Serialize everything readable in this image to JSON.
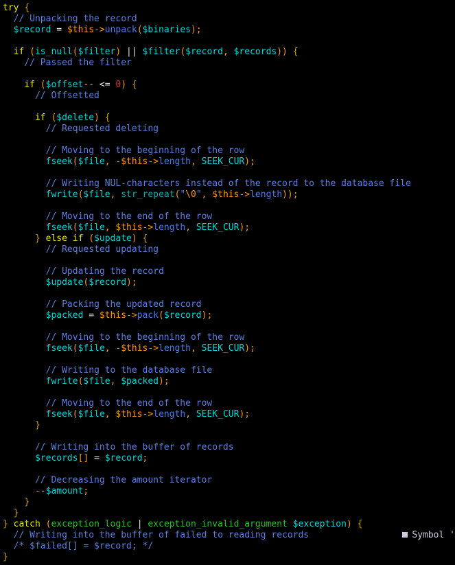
{
  "editor": {
    "background_color": "#000000",
    "font_size_px": 13,
    "line_height_px": 16,
    "language": "PHP"
  },
  "colors": {
    "keyword": "#e8e800",
    "brace": "#c8a000",
    "comment": "#5c7fe0",
    "variable": "#00d8d8",
    "this_variable": "#ff9800",
    "punctuation": "#ff9800",
    "property": "#4a7ae8",
    "function": "#00d8d8",
    "function_secondary": "#13a8a8",
    "operator": "#e6e6e6",
    "number": "#d03030",
    "string": "#4a7ae8",
    "escape": "#ff9800",
    "class_name": "#2bbf2b"
  },
  "overlay": {
    "marker": "square-marker",
    "label": "Symbol",
    "trailing": "'"
  },
  "lines": [
    {
      "n": 1,
      "text": "try {"
    },
    {
      "n": 2,
      "text": "  // Unpacking the record"
    },
    {
      "n": 3,
      "text": "  $record = $this->unpack($binaries);"
    },
    {
      "n": 4,
      "text": ""
    },
    {
      "n": 5,
      "text": "  if (is_null($filter) || $filter($record, $records)) {"
    },
    {
      "n": 6,
      "text": "    // Passed the filter"
    },
    {
      "n": 7,
      "text": ""
    },
    {
      "n": 8,
      "text": "    if ($offset-- <= 0) {"
    },
    {
      "n": 9,
      "text": "      // Offsetted"
    },
    {
      "n": 10,
      "text": ""
    },
    {
      "n": 11,
      "text": "      if ($delete) {"
    },
    {
      "n": 12,
      "text": "        // Requested deleting"
    },
    {
      "n": 13,
      "text": ""
    },
    {
      "n": 14,
      "text": "        // Moving to the beginning of the row"
    },
    {
      "n": 15,
      "text": "        fseek($file, -$this->length, SEEK_CUR);"
    },
    {
      "n": 16,
      "text": ""
    },
    {
      "n": 17,
      "text": "        // Writing NUL-characters instead of the record to the database file"
    },
    {
      "n": 18,
      "text": "        fwrite($file, str_repeat(\"\\0\", $this->length));"
    },
    {
      "n": 19,
      "text": ""
    },
    {
      "n": 20,
      "text": "        // Moving to the end of the row"
    },
    {
      "n": 21,
      "text": "        fseek($file, $this->length, SEEK_CUR);"
    },
    {
      "n": 22,
      "text": "      } else if ($update) {"
    },
    {
      "n": 23,
      "text": "        // Requested updating"
    },
    {
      "n": 24,
      "text": ""
    },
    {
      "n": 25,
      "text": "        // Updating the record"
    },
    {
      "n": 26,
      "text": "        $update($record);"
    },
    {
      "n": 27,
      "text": ""
    },
    {
      "n": 28,
      "text": "        // Packing the updated record"
    },
    {
      "n": 29,
      "text": "        $packed = $this->pack($record);"
    },
    {
      "n": 30,
      "text": ""
    },
    {
      "n": 31,
      "text": "        // Moving to the beginning of the row"
    },
    {
      "n": 32,
      "text": "        fseek($file, -$this->length, SEEK_CUR);"
    },
    {
      "n": 33,
      "text": ""
    },
    {
      "n": 34,
      "text": "        // Writing to the database file"
    },
    {
      "n": 35,
      "text": "        fwrite($file, $packed);"
    },
    {
      "n": 36,
      "text": ""
    },
    {
      "n": 37,
      "text": "        // Moving to the end of the row"
    },
    {
      "n": 38,
      "text": "        fseek($file, $this->length, SEEK_CUR);"
    },
    {
      "n": 39,
      "text": "      }"
    },
    {
      "n": 40,
      "text": ""
    },
    {
      "n": 41,
      "text": "      // Writing into the buffer of records"
    },
    {
      "n": 42,
      "text": "      $records[] = $record;"
    },
    {
      "n": 43,
      "text": ""
    },
    {
      "n": 44,
      "text": "      // Decreasing the amount iterator"
    },
    {
      "n": 45,
      "text": "      --$amount;"
    },
    {
      "n": 46,
      "text": "    }"
    },
    {
      "n": 47,
      "text": "  }"
    },
    {
      "n": 48,
      "text": "} catch (exception_logic | exception_invalid_argument $exception) {"
    },
    {
      "n": 49,
      "text": "  // Writing into the buffer of failed to reading records"
    },
    {
      "n": 50,
      "text": "  /* $failed[] = $record; */"
    },
    {
      "n": 51,
      "text": "}"
    }
  ],
  "tokens": [
    [
      [
        "t-kw",
        "try"
      ],
      [
        "t-plain",
        " "
      ],
      [
        "t-brace",
        "{"
      ]
    ],
    [
      [
        "t-plain",
        "  "
      ],
      [
        "t-comment",
        "// Unpacking the record"
      ]
    ],
    [
      [
        "t-plain",
        "  "
      ],
      [
        "t-var",
        "$record"
      ],
      [
        "t-plain",
        " "
      ],
      [
        "t-op",
        "="
      ],
      [
        "t-plain",
        " "
      ],
      [
        "t-this",
        "$this"
      ],
      [
        "t-punc",
        "->"
      ],
      [
        "t-prop",
        "unpack"
      ],
      [
        "t-punc",
        "("
      ],
      [
        "t-var",
        "$binaries"
      ],
      [
        "t-punc",
        ");"
      ]
    ],
    [],
    [
      [
        "t-plain",
        "  "
      ],
      [
        "t-kw",
        "if"
      ],
      [
        "t-plain",
        " "
      ],
      [
        "t-punc",
        "("
      ],
      [
        "t-func",
        "is_null"
      ],
      [
        "t-punc",
        "("
      ],
      [
        "t-var",
        "$filter"
      ],
      [
        "t-punc",
        ")"
      ],
      [
        "t-plain",
        " "
      ],
      [
        "t-op",
        "||"
      ],
      [
        "t-plain",
        " "
      ],
      [
        "t-var",
        "$filter"
      ],
      [
        "t-punc",
        "("
      ],
      [
        "t-var",
        "$record"
      ],
      [
        "t-punc",
        ","
      ],
      [
        "t-plain",
        " "
      ],
      [
        "t-var",
        "$records"
      ],
      [
        "t-punc",
        "))"
      ],
      [
        "t-plain",
        " "
      ],
      [
        "t-brace",
        "{"
      ]
    ],
    [
      [
        "t-plain",
        "    "
      ],
      [
        "t-comment",
        "// Passed the filter"
      ]
    ],
    [],
    [
      [
        "t-plain",
        "    "
      ],
      [
        "t-kw",
        "if"
      ],
      [
        "t-plain",
        " "
      ],
      [
        "t-punc",
        "("
      ],
      [
        "t-var",
        "$offset"
      ],
      [
        "t-punc",
        "--"
      ],
      [
        "t-plain",
        " "
      ],
      [
        "t-op",
        "<="
      ],
      [
        "t-plain",
        " "
      ],
      [
        "t-num",
        "0"
      ],
      [
        "t-punc",
        ")"
      ],
      [
        "t-plain",
        " "
      ],
      [
        "t-brace",
        "{"
      ]
    ],
    [
      [
        "t-plain",
        "      "
      ],
      [
        "t-comment",
        "// Offsetted"
      ]
    ],
    [],
    [
      [
        "t-plain",
        "      "
      ],
      [
        "t-kw",
        "if"
      ],
      [
        "t-plain",
        " "
      ],
      [
        "t-punc",
        "("
      ],
      [
        "t-var",
        "$delete"
      ],
      [
        "t-punc",
        ")"
      ],
      [
        "t-plain",
        " "
      ],
      [
        "t-brace",
        "{"
      ]
    ],
    [
      [
        "t-plain",
        "        "
      ],
      [
        "t-comment",
        "// Requested deleting"
      ]
    ],
    [],
    [
      [
        "t-plain",
        "        "
      ],
      [
        "t-comment",
        "// Moving to the beginning of the row"
      ]
    ],
    [
      [
        "t-plain",
        "        "
      ],
      [
        "t-func",
        "fseek"
      ],
      [
        "t-punc",
        "("
      ],
      [
        "t-var",
        "$file"
      ],
      [
        "t-punc",
        ","
      ],
      [
        "t-plain",
        " "
      ],
      [
        "t-punc",
        "-"
      ],
      [
        "t-this",
        "$this"
      ],
      [
        "t-punc",
        "->"
      ],
      [
        "t-prop",
        "length"
      ],
      [
        "t-punc",
        ","
      ],
      [
        "t-plain",
        " "
      ],
      [
        "t-func",
        "SEEK_CUR"
      ],
      [
        "t-punc",
        ");"
      ]
    ],
    [],
    [
      [
        "t-plain",
        "        "
      ],
      [
        "t-comment",
        "// Writing NUL-characters instead of the record to the database file"
      ]
    ],
    [
      [
        "t-plain",
        "        "
      ],
      [
        "t-func",
        "fwrite"
      ],
      [
        "t-punc",
        "("
      ],
      [
        "t-var",
        "$file"
      ],
      [
        "t-punc",
        ","
      ],
      [
        "t-plain",
        " "
      ],
      [
        "t-func2",
        "str_repeat"
      ],
      [
        "t-punc",
        "("
      ],
      [
        "t-str",
        "\""
      ],
      [
        "t-esc",
        "\\0"
      ],
      [
        "t-str",
        "\""
      ],
      [
        "t-punc",
        ","
      ],
      [
        "t-plain",
        " "
      ],
      [
        "t-this",
        "$this"
      ],
      [
        "t-punc",
        "->"
      ],
      [
        "t-prop",
        "length"
      ],
      [
        "t-punc",
        "));"
      ]
    ],
    [],
    [
      [
        "t-plain",
        "        "
      ],
      [
        "t-comment",
        "// Moving to the end of the row"
      ]
    ],
    [
      [
        "t-plain",
        "        "
      ],
      [
        "t-func",
        "fseek"
      ],
      [
        "t-punc",
        "("
      ],
      [
        "t-var",
        "$file"
      ],
      [
        "t-punc",
        ","
      ],
      [
        "t-plain",
        " "
      ],
      [
        "t-this",
        "$this"
      ],
      [
        "t-punc",
        "->"
      ],
      [
        "t-prop",
        "length"
      ],
      [
        "t-punc",
        ","
      ],
      [
        "t-plain",
        " "
      ],
      [
        "t-func",
        "SEEK_CUR"
      ],
      [
        "t-punc",
        ");"
      ]
    ],
    [
      [
        "t-plain",
        "      "
      ],
      [
        "t-brace",
        "}"
      ],
      [
        "t-plain",
        " "
      ],
      [
        "t-kw",
        "else if"
      ],
      [
        "t-plain",
        " "
      ],
      [
        "t-punc",
        "("
      ],
      [
        "t-var",
        "$update"
      ],
      [
        "t-punc",
        ")"
      ],
      [
        "t-plain",
        " "
      ],
      [
        "t-brace",
        "{"
      ]
    ],
    [
      [
        "t-plain",
        "        "
      ],
      [
        "t-comment",
        "// Requested updating"
      ]
    ],
    [],
    [
      [
        "t-plain",
        "        "
      ],
      [
        "t-comment",
        "// Updating the record"
      ]
    ],
    [
      [
        "t-plain",
        "        "
      ],
      [
        "t-var",
        "$update"
      ],
      [
        "t-punc",
        "("
      ],
      [
        "t-var",
        "$record"
      ],
      [
        "t-punc",
        ");"
      ]
    ],
    [],
    [
      [
        "t-plain",
        "        "
      ],
      [
        "t-comment",
        "// Packing the updated record"
      ]
    ],
    [
      [
        "t-plain",
        "        "
      ],
      [
        "t-var",
        "$packed"
      ],
      [
        "t-plain",
        " "
      ],
      [
        "t-op",
        "="
      ],
      [
        "t-plain",
        " "
      ],
      [
        "t-this",
        "$this"
      ],
      [
        "t-punc",
        "->"
      ],
      [
        "t-prop",
        "pack"
      ],
      [
        "t-punc",
        "("
      ],
      [
        "t-var",
        "$record"
      ],
      [
        "t-punc",
        ");"
      ]
    ],
    [],
    [
      [
        "t-plain",
        "        "
      ],
      [
        "t-comment",
        "// Moving to the beginning of the row"
      ]
    ],
    [
      [
        "t-plain",
        "        "
      ],
      [
        "t-func",
        "fseek"
      ],
      [
        "t-punc",
        "("
      ],
      [
        "t-var",
        "$file"
      ],
      [
        "t-punc",
        ","
      ],
      [
        "t-plain",
        " "
      ],
      [
        "t-punc",
        "-"
      ],
      [
        "t-this",
        "$this"
      ],
      [
        "t-punc",
        "->"
      ],
      [
        "t-prop",
        "length"
      ],
      [
        "t-punc",
        ","
      ],
      [
        "t-plain",
        " "
      ],
      [
        "t-func",
        "SEEK_CUR"
      ],
      [
        "t-punc",
        ");"
      ]
    ],
    [],
    [
      [
        "t-plain",
        "        "
      ],
      [
        "t-comment",
        "// Writing to the database file"
      ]
    ],
    [
      [
        "t-plain",
        "        "
      ],
      [
        "t-func",
        "fwrite"
      ],
      [
        "t-punc",
        "("
      ],
      [
        "t-var",
        "$file"
      ],
      [
        "t-punc",
        ","
      ],
      [
        "t-plain",
        " "
      ],
      [
        "t-var",
        "$packed"
      ],
      [
        "t-punc",
        ");"
      ]
    ],
    [],
    [
      [
        "t-plain",
        "        "
      ],
      [
        "t-comment",
        "// Moving to the end of the row"
      ]
    ],
    [
      [
        "t-plain",
        "        "
      ],
      [
        "t-func",
        "fseek"
      ],
      [
        "t-punc",
        "("
      ],
      [
        "t-var",
        "$file"
      ],
      [
        "t-punc",
        ","
      ],
      [
        "t-plain",
        " "
      ],
      [
        "t-this",
        "$this"
      ],
      [
        "t-punc",
        "->"
      ],
      [
        "t-prop",
        "length"
      ],
      [
        "t-punc",
        ","
      ],
      [
        "t-plain",
        " "
      ],
      [
        "t-func",
        "SEEK_CUR"
      ],
      [
        "t-punc",
        ");"
      ]
    ],
    [
      [
        "t-plain",
        "      "
      ],
      [
        "t-brace",
        "}"
      ]
    ],
    [],
    [
      [
        "t-plain",
        "      "
      ],
      [
        "t-comment",
        "// Writing into the buffer of records"
      ]
    ],
    [
      [
        "t-plain",
        "      "
      ],
      [
        "t-var",
        "$records"
      ],
      [
        "t-punc",
        "[]"
      ],
      [
        "t-plain",
        " "
      ],
      [
        "t-op",
        "="
      ],
      [
        "t-plain",
        " "
      ],
      [
        "t-var",
        "$record"
      ],
      [
        "t-punc",
        ";"
      ]
    ],
    [],
    [
      [
        "t-plain",
        "      "
      ],
      [
        "t-comment",
        "// Decreasing the amount iterator"
      ]
    ],
    [
      [
        "t-plain",
        "      "
      ],
      [
        "t-punc",
        "--"
      ],
      [
        "t-var",
        "$amount"
      ],
      [
        "t-punc",
        ";"
      ]
    ],
    [
      [
        "t-plain",
        "    "
      ],
      [
        "t-brace",
        "}"
      ]
    ],
    [
      [
        "t-plain",
        "  "
      ],
      [
        "t-brace",
        "}"
      ]
    ],
    [
      [
        "t-brace",
        "}"
      ],
      [
        "t-plain",
        " "
      ],
      [
        "t-kw",
        "catch"
      ],
      [
        "t-plain",
        " "
      ],
      [
        "t-punc",
        "("
      ],
      [
        "t-class",
        "exception_logic"
      ],
      [
        "t-plain",
        " "
      ],
      [
        "t-op",
        "|"
      ],
      [
        "t-plain",
        " "
      ],
      [
        "t-class",
        "exception_invalid_argument"
      ],
      [
        "t-plain",
        " "
      ],
      [
        "t-var",
        "$exception"
      ],
      [
        "t-punc",
        ")"
      ],
      [
        "t-plain",
        " "
      ],
      [
        "t-brace",
        "{"
      ]
    ],
    [
      [
        "t-plain",
        "  "
      ],
      [
        "t-comment",
        "// Writing into the buffer of failed to reading records"
      ]
    ],
    [
      [
        "t-plain",
        "  "
      ],
      [
        "t-comment",
        "/* $failed[] = $record; */"
      ]
    ],
    [
      [
        "t-brace",
        "}"
      ]
    ]
  ]
}
